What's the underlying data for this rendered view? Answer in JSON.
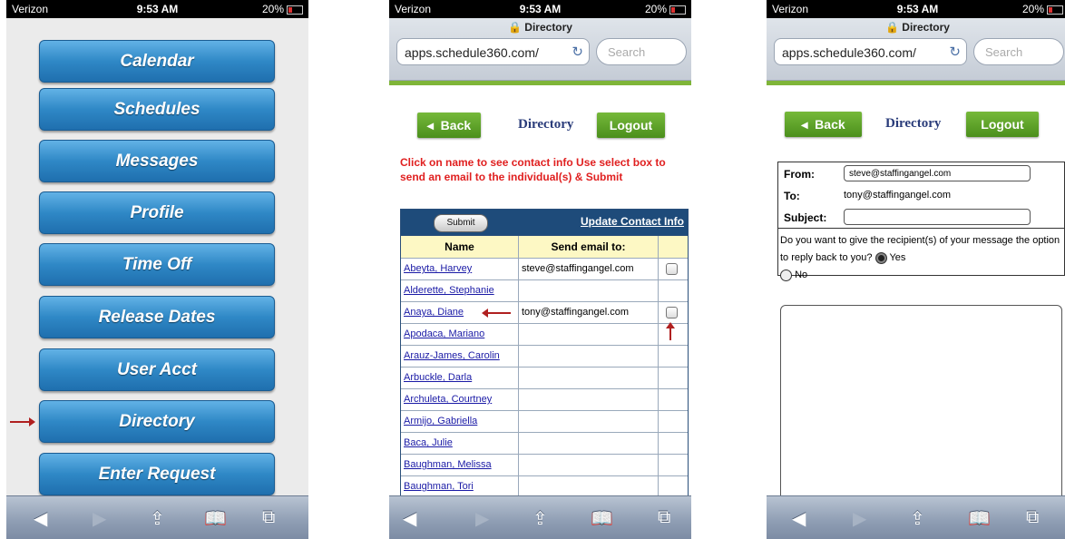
{
  "status": {
    "carrier": "Verizon",
    "time": "9:53 AM",
    "battery": "20%"
  },
  "panel1": {
    "menu": [
      "Calendar",
      "Schedules",
      "Messages",
      "Profile",
      "Time Off",
      "Release Dates",
      "User Acct",
      "Directory",
      "Enter Request"
    ]
  },
  "browser": {
    "tab_title": "Directory",
    "url": "apps.schedule360.com/",
    "search_placeholder": "Search"
  },
  "header": {
    "back_label": "Back",
    "title": "Directory",
    "logout_label": "Logout"
  },
  "panel2": {
    "instructions": "Click on name to see contact info Use select box to send an email to the individual(s) & Submit",
    "submit_label": "Submit",
    "update_link": "Update Contact Info",
    "col_name": "Name",
    "col_email": "Send email to:",
    "rows": [
      {
        "name": "Abeyta, Harvey",
        "email": "steve@staffingangel.com"
      },
      {
        "name": "Alderette, Stephanie",
        "email": ""
      },
      {
        "name": "Anaya, Diane",
        "email": "tony@staffingangel.com"
      },
      {
        "name": "Apodaca, Mariano",
        "email": ""
      },
      {
        "name": "Arauz-James, Carolin",
        "email": ""
      },
      {
        "name": "Arbuckle, Darla",
        "email": ""
      },
      {
        "name": "Archuleta, Courtney",
        "email": ""
      },
      {
        "name": "Armijo, Gabriella",
        "email": ""
      },
      {
        "name": "Baca, Julie",
        "email": ""
      },
      {
        "name": "Baughman, Melissa",
        "email": ""
      },
      {
        "name": "Baughman, Tori",
        "email": ""
      }
    ]
  },
  "panel3": {
    "from_label": "From:",
    "from_value": "steve@staffingangel.com",
    "to_label": "To:",
    "to_value": "tony@staffingangel.com",
    "subject_label": "Subject:",
    "subject_value": "",
    "question": "Do you want to give the recipient(s) of your message the option to reply back to you?",
    "yes_label": "Yes",
    "no_label": "No"
  },
  "toolbar": {
    "back": "◀",
    "forward": "▶",
    "share": "⇪",
    "bookmarks": "📖",
    "tabs": "⧉"
  }
}
